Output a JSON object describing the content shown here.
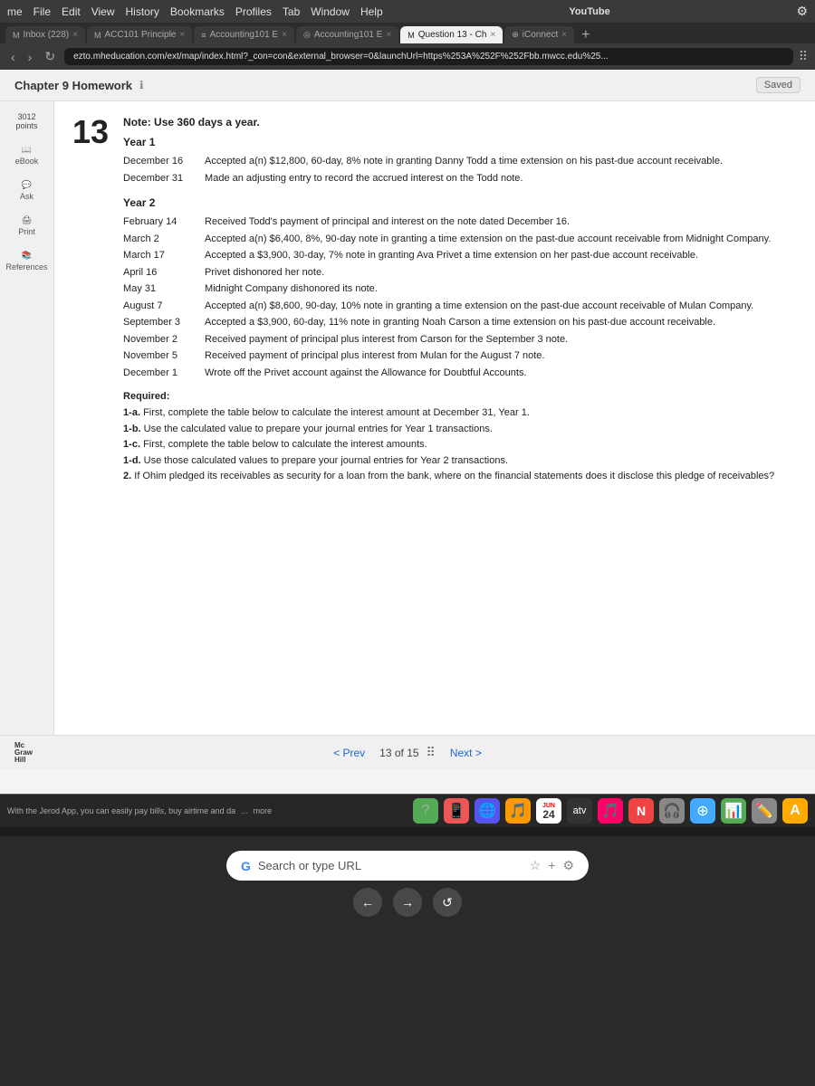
{
  "browser": {
    "menu_items": [
      "me",
      "File",
      "Edit",
      "View",
      "History",
      "Bookmarks",
      "Profiles",
      "Tab",
      "Window",
      "Help"
    ],
    "tabs": [
      {
        "label": "Inbox (228)",
        "prefix": "M",
        "active": false
      },
      {
        "label": "ACC101 Principle",
        "prefix": "M",
        "active": false
      },
      {
        "label": "Accounting101 E",
        "prefix": "≡",
        "active": false
      },
      {
        "label": "Accounting101 E",
        "prefix": "◎",
        "active": false
      },
      {
        "label": "Question 13 - Ch",
        "prefix": "M",
        "active": true
      },
      {
        "label": "iConnect",
        "prefix": "⊕",
        "active": false
      }
    ],
    "youtube_search": "YouTube",
    "address_bar": "ezto.mheducation.com/ext/map/index.html?_con=con&external_browser=0&launchUrl=https%253A%252F%252Fbb.mwcc.edu%25..."
  },
  "page": {
    "chapter_title": "Chapter 9 Homework",
    "saved_label": "Saved",
    "question_number": "13",
    "note": "Note: Use 360 days a year.",
    "points": "3012",
    "points_label": "points",
    "year1_heading": "Year 1",
    "year1_entries": [
      {
        "date": "December 16",
        "text": "Accepted a(n) $12,800, 60-day, 8% note in granting Danny Todd a time extension on his past-due account receivable."
      },
      {
        "date": "December 31",
        "text": "Made an adjusting entry to record the accrued interest on the Todd note."
      }
    ],
    "year2_heading": "Year 2",
    "year2_entries": [
      {
        "date": "February 14",
        "text": "Received Todd's payment of principal and interest on the note dated December 16."
      },
      {
        "date": "March 2",
        "text": "Accepted a(n) $6,400, 8%, 90-day note in granting a time extension on the past-due account receivable from Midnight Company."
      },
      {
        "date": "March 17",
        "text": "Accepted a $3,900, 30-day, 7% note in granting Ava Privet a time extension on her past-due account receivable."
      },
      {
        "date": "April 16",
        "text": "Privet dishonored her note."
      },
      {
        "date": "May 31",
        "text": "Midnight Company dishonored its note."
      },
      {
        "date": "August 7",
        "text": "Accepted a(n) $8,600, 90-day, 10% note in granting a time extension on the past-due account receivable of Mulan Company."
      },
      {
        "date": "September 3",
        "text": "Accepted a $3,900, 60-day, 11% note in granting Noah Carson a time extension on his past-due account receivable."
      },
      {
        "date": "November 2",
        "text": "Received payment of principal plus interest from Carson for the September 3 note."
      },
      {
        "date": "November 5",
        "text": "Received payment of principal plus interest from Mulan for the August 7 note."
      },
      {
        "date": "December 1",
        "text": "Wrote off the Privet account against the Allowance for Doubtful Accounts."
      }
    ],
    "required_heading": "Required:",
    "required_items": [
      {
        "label": "1-a.",
        "text": "First, complete the table below to calculate the interest amount at December 31, Year 1."
      },
      {
        "label": "1-b.",
        "text": "Use the calculated value to prepare your journal entries for Year 1 transactions."
      },
      {
        "label": "1-c.",
        "text": "First, complete the table below to calculate the interest amounts."
      },
      {
        "label": "1-d.",
        "text": "Use those calculated values to prepare your journal entries for Year 2 transactions."
      },
      {
        "label": "2.",
        "text": "If Ohim pledged its receivables as security for a loan from the bank, where on the financial statements does it disclose this pledge of receivables?"
      }
    ]
  },
  "bottom_nav": {
    "prev_label": "< Prev",
    "page_info": "13 of 15",
    "next_label": "Next >",
    "brand": [
      "Mc",
      "Graw",
      "Hill"
    ]
  },
  "taskbar": {
    "message": "With the Jerod App, you can easily pay bills, buy airtime and da",
    "more_label": "more"
  },
  "dock": {
    "icons": [
      "?",
      "📱",
      "🌐",
      "🎵",
      "📅",
      "⚙️",
      "📺",
      "🎵",
      "N",
      "🎧",
      "⊕",
      "📊",
      "✏️",
      "A"
    ]
  },
  "keyboard_area": {
    "google_logo": "G",
    "search_placeholder": "Search or type URL",
    "back_arrow": "←",
    "forward_arrow": "→",
    "refresh": "↺"
  },
  "date_display": "24"
}
